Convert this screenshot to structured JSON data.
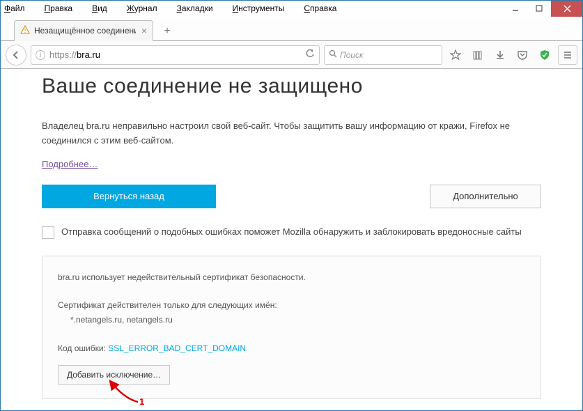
{
  "menubar": {
    "file": "Файл",
    "edit": "Правка",
    "view": "Вид",
    "history": "Журнал",
    "bookmarks": "Закладки",
    "tools": "Инструменты",
    "help": "Справка"
  },
  "tab": {
    "title": "Незащищённое соединени",
    "close": "×",
    "new": "+"
  },
  "url": {
    "protocol": "https://",
    "domain": "bra.ru"
  },
  "search": {
    "placeholder": "Поиск"
  },
  "page": {
    "heading": "Ваше соединение не защищено",
    "message": "Владелец bra.ru неправильно настроил свой веб-сайт. Чтобы защитить вашу информацию от кражи, Firefox не соединился с этим веб-сайтом.",
    "learn_more": "Подробнее…",
    "go_back": "Вернуться назад",
    "advanced": "Дополнительно",
    "report_label": "Отправка сообщений о подобных ошибках поможет Mozilla обнаружить и заблокировать вредоносные сайты",
    "cert_msg": "bra.ru использует недействительный сертификат безопасности.",
    "valid_for": "Сертификат действителен только для следующих имён:",
    "names": "*.netangels.ru, netangels.ru",
    "error_label": "Код ошибки:",
    "error_code": "SSL_ERROR_BAD_CERT_DOMAIN",
    "add_exception": "Добавить исключение…"
  },
  "annotation": {
    "label": "1"
  }
}
